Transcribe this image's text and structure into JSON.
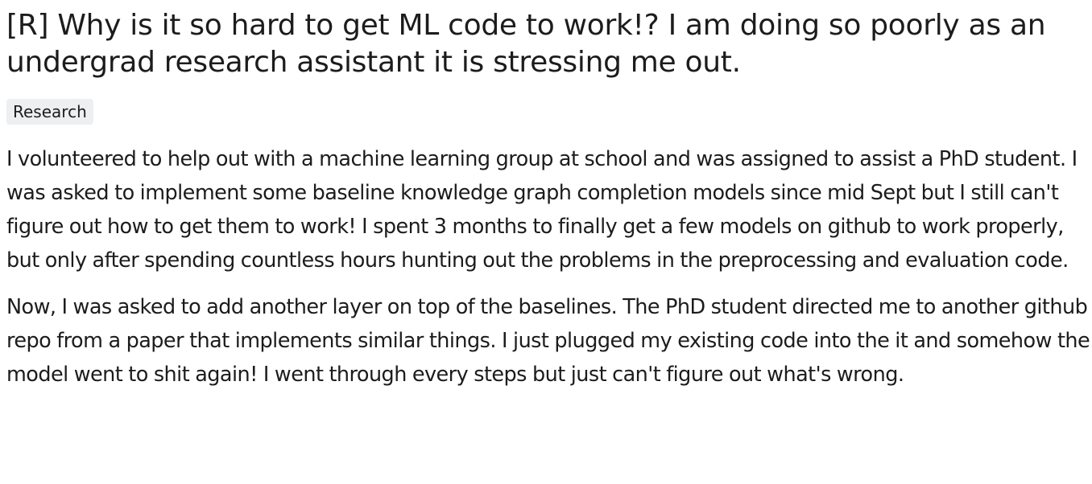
{
  "post": {
    "title": "[R] Why is it so hard to get ML code to work!? I am doing so poorly as an undergrad research assistant it is stressing me out.",
    "flair": "Research",
    "paragraphs": [
      "I volunteered to help out with a machine learning group at school and was assigned to assist a PhD student. I was asked to implement some baseline knowledge graph completion models since mid Sept but I still can't figure out how to get them to work! I spent 3 months to finally get a few models on github to work properly, but only after spending countless hours hunting out the problems in the preprocessing and evaluation code.",
      "Now, I was asked to add another layer on top of the baselines. The PhD student directed me to another github repo from a paper that implements similar things. I just plugged my existing code into the it and somehow the model went to shit again! I went through every steps but just can't figure out what's wrong."
    ]
  }
}
